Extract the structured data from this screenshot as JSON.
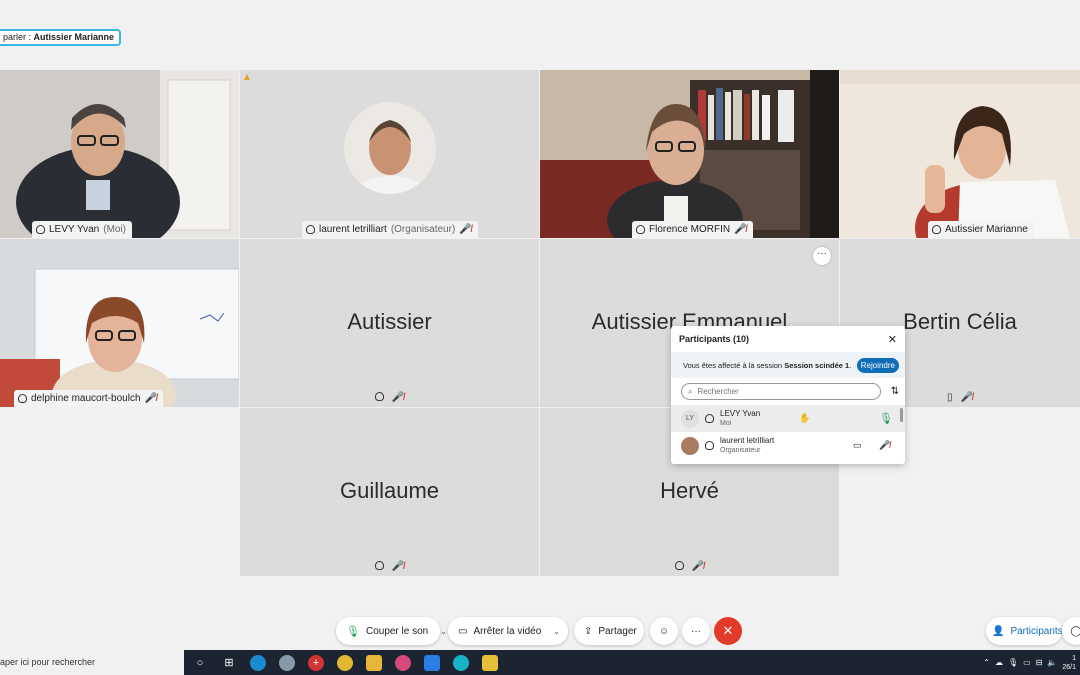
{
  "speaking": {
    "prefix": "parler : ",
    "name": "Autissier Marianne"
  },
  "tiles": [
    {
      "name": "LEVY Yvan",
      "role": "(Moi)"
    },
    {
      "name": "laurent letrilliart",
      "role": "(Organisateur)"
    },
    {
      "name": "Florence MORFIN",
      "role": ""
    },
    {
      "name": "Autissier Marianne",
      "role": ""
    },
    {
      "name": "delphine maucort-boulch",
      "role": ""
    },
    {
      "name": "Autissier",
      "role": ""
    },
    {
      "name": "Autissier Emmanuel",
      "role": ""
    },
    {
      "name": "Bertin Célia",
      "role": ""
    },
    {
      "name": "Guillaume",
      "role": ""
    },
    {
      "name": "Hervé",
      "role": ""
    }
  ],
  "participants_panel": {
    "title": "Participants (10)",
    "banner_text": "Vous êtes affecté à la session ",
    "session_name": "Session scindée 1",
    "banner_end": ".",
    "join_label": "Rejoindre",
    "search_placeholder": "Rechercher",
    "rows": [
      {
        "initials": "LY",
        "name": "LEVY Yvan",
        "sub": "Moi"
      },
      {
        "initials": "",
        "name": "laurent letrilliart",
        "sub": "Organisateur"
      }
    ]
  },
  "controls": {
    "mute_label": "Couper le son",
    "video_label": "Arrêter la vidéo",
    "share_label": "Partager",
    "participants_label": "Participants"
  },
  "taskbar": {
    "search_text": "aper ici pour rechercher",
    "clock_line1": "1",
    "clock_line2": "26/1"
  },
  "colors": {
    "accent": "#39b7e3",
    "end_call": "#e23b2c",
    "join": "#0f6db6"
  }
}
